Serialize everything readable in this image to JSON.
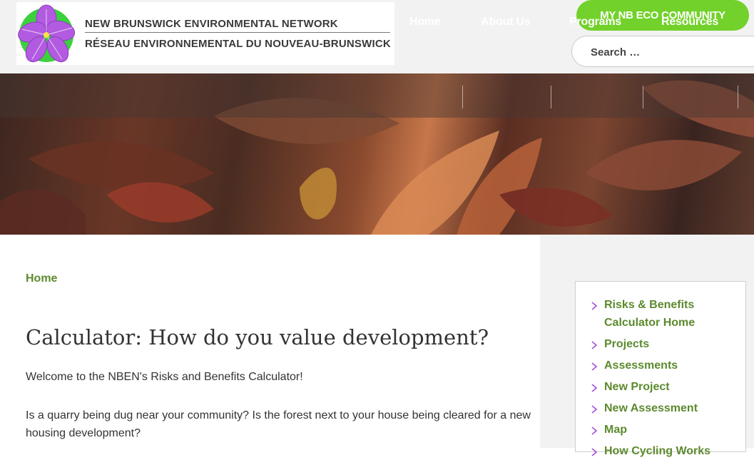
{
  "logo": {
    "line1": "NEW BRUNSWICK ENVIRONMENTAL NETWORK",
    "line2": "RÉSEAU ENVIRONNEMENTAL DU NOUVEAU-BRUNSWICK",
    "icon": "violet-flower-icon"
  },
  "header": {
    "eco_button": "MY NB ECO COMMUNITY",
    "search_placeholder": "Search …"
  },
  "nav": {
    "items": [
      "Home",
      "About Us",
      "Programs",
      "Resources"
    ]
  },
  "breadcrumb": "Home",
  "main": {
    "title": "Calculator: How do you value development?",
    "intro": "Welcome to the NBEN's Risks and Benefits Calculator!",
    "paragraph": "Is a quarry being dug near your community? Is the forest next to your house being cleared for a new housing development?"
  },
  "sidebar": {
    "items": [
      "Risks & Benefits Calculator Home",
      "Projects",
      "Assessments",
      "New Project",
      "New Assessment",
      "Map",
      "How Cycling Works"
    ]
  },
  "colors": {
    "accent_green": "#72d12a",
    "link_green": "#5c8a2e",
    "flower_purple": "#a84fd8"
  }
}
